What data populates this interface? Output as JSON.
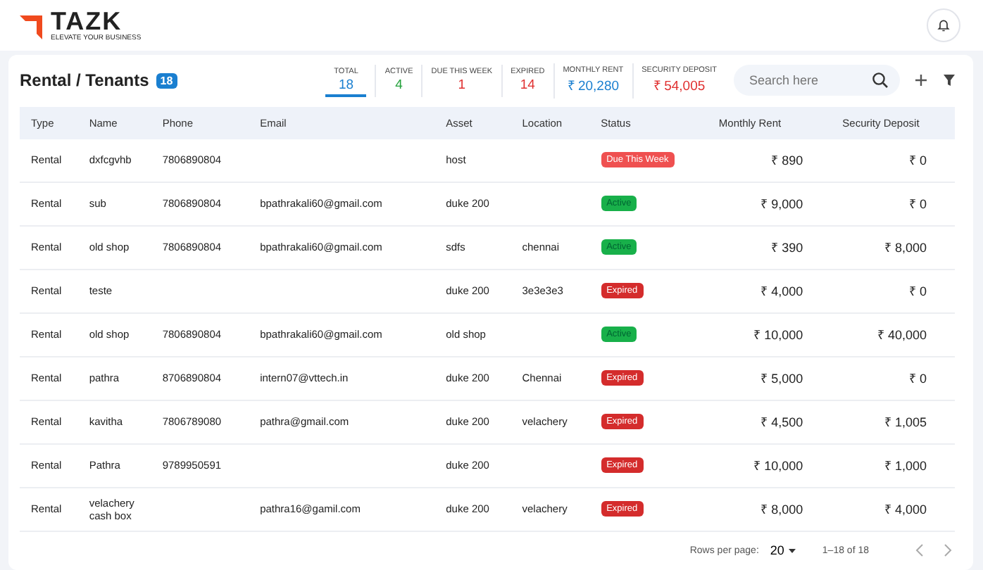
{
  "header": {
    "logo": "TAZK",
    "tagline": "ELEVATE YOUR BUSINESS"
  },
  "page": {
    "title": "Rental / Tenants",
    "count": "18"
  },
  "stats": [
    {
      "label": "TOTAL",
      "value": "18",
      "color": "#1a7fd0",
      "selected": true
    },
    {
      "label": "ACTIVE",
      "value": "4",
      "color": "#22a03a",
      "selected": false
    },
    {
      "label": "DUE THIS WEEK",
      "value": "1",
      "color": "#e03030",
      "selected": false
    },
    {
      "label": "EXPIRED",
      "value": "14",
      "color": "#e03030",
      "selected": false
    },
    {
      "label": "MONTHLY RENT",
      "value": "₹ 20,280",
      "color": "#1a7fd0",
      "selected": false
    },
    {
      "label": "SECURITY DEPOSIT",
      "value": "₹ 54,005",
      "color": "#e03030",
      "selected": false
    }
  ],
  "search": {
    "placeholder": "Search here"
  },
  "table": {
    "columns": [
      "Type",
      "Name",
      "Phone",
      "Email",
      "Asset",
      "Location",
      "Status",
      "Monthly Rent",
      "Security Deposit"
    ],
    "rows": [
      {
        "type": "Rental",
        "name": "dxfcgvhb",
        "phone": "7806890804",
        "email": "",
        "asset": "host",
        "location": "",
        "status": {
          "text": "Due This Week",
          "kind": "due"
        },
        "rent": "₹ 890",
        "deposit": "₹ 0"
      },
      {
        "type": "Rental",
        "name": "sub",
        "phone": "7806890804",
        "email": "bpathrakali60@gmail.com",
        "asset": "duke 200",
        "location": "",
        "status": {
          "text": "Active",
          "kind": "active"
        },
        "rent": "₹ 9,000",
        "deposit": "₹ 0"
      },
      {
        "type": "Rental",
        "name": "old shop",
        "phone": "7806890804",
        "email": "bpathrakali60@gmail.com",
        "asset": "sdfs",
        "location": "chennai",
        "status": {
          "text": "Active",
          "kind": "active"
        },
        "rent": "₹ 390",
        "deposit": "₹ 8,000"
      },
      {
        "type": "Rental",
        "name": "teste",
        "phone": "",
        "email": "",
        "asset": "duke 200",
        "location": "3e3e3e3",
        "status": {
          "text": "Expired",
          "kind": "expired"
        },
        "rent": "₹ 4,000",
        "deposit": "₹ 0"
      },
      {
        "type": "Rental",
        "name": "old shop",
        "phone": "7806890804",
        "email": "bpathrakali60@gmail.com",
        "asset": "old shop",
        "location": "",
        "status": {
          "text": "Active",
          "kind": "active"
        },
        "rent": "₹ 10,000",
        "deposit": "₹ 40,000"
      },
      {
        "type": "Rental",
        "name": "pathra",
        "phone": "8706890804",
        "email": "intern07@vttech.in",
        "asset": "duke 200",
        "location": "Chennai",
        "status": {
          "text": "Expired",
          "kind": "expired"
        },
        "rent": "₹ 5,000",
        "deposit": "₹ 0"
      },
      {
        "type": "Rental",
        "name": "kavitha",
        "phone": "7806789080",
        "email": "pathra@gmail.com",
        "asset": "duke 200",
        "location": "velachery",
        "status": {
          "text": "Expired",
          "kind": "expired"
        },
        "rent": "₹ 4,500",
        "deposit": "₹ 1,005"
      },
      {
        "type": "Rental",
        "name": "Pathra",
        "phone": "9789950591",
        "email": "",
        "asset": "duke 200",
        "location": "",
        "status": {
          "text": "Expired",
          "kind": "expired"
        },
        "rent": "₹ 10,000",
        "deposit": "₹ 1,000"
      },
      {
        "type": "Rental",
        "name": "velachery cash box",
        "phone": "",
        "email": "pathra16@gamil.com",
        "asset": "duke 200",
        "location": "velachery",
        "status": {
          "text": "Expired",
          "kind": "expired"
        },
        "rent": "₹ 8,000",
        "deposit": "₹ 4,000"
      }
    ]
  },
  "pagination": {
    "rows_label": "Rows per page:",
    "rows_value": "20",
    "range": "1–18 of 18"
  }
}
